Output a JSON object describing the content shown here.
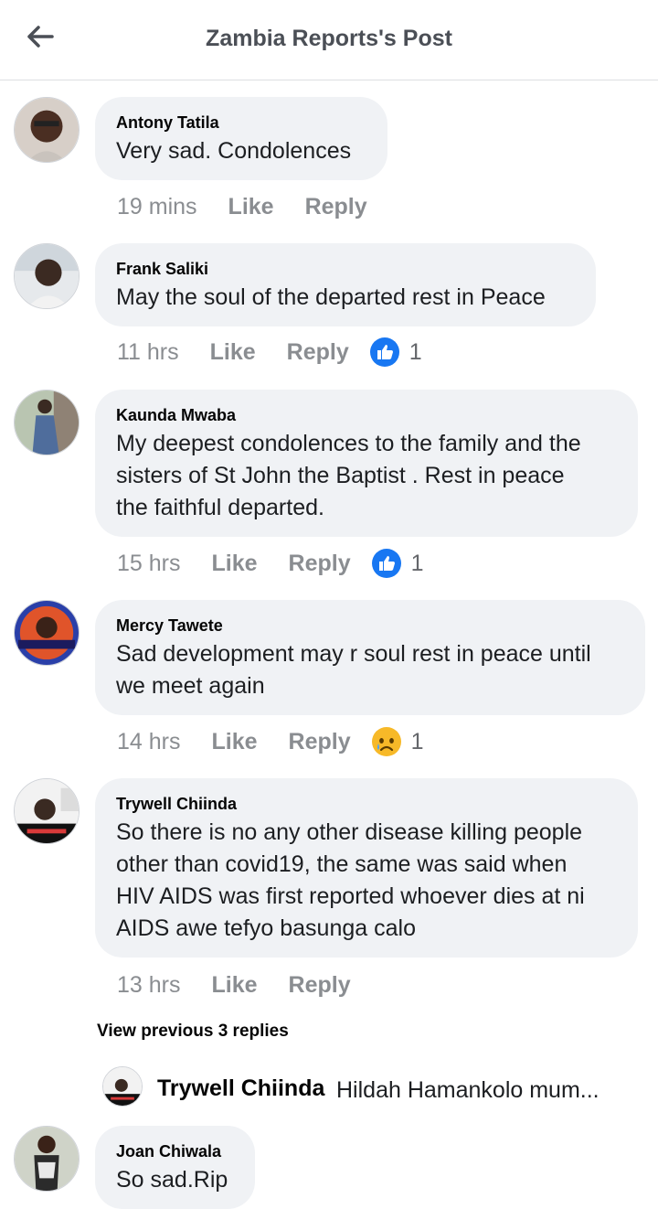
{
  "header": {
    "title": "Zambia Reports's Post"
  },
  "comments": [
    {
      "author": "Antony Tatila",
      "text": "Very sad. Condolences",
      "time": "19 mins",
      "like": "Like",
      "reply": "Reply",
      "reaction": "",
      "count": ""
    },
    {
      "author": "Frank Saliki",
      "text": "May the soul of the departed rest in Peace",
      "time": "11 hrs",
      "like": "Like",
      "reply": "Reply",
      "reaction": "like",
      "count": "1"
    },
    {
      "author": "Kaunda Mwaba",
      "text": "My deepest condolences to the family and the\nsisters of St John the Baptist . Rest in peace\nthe faithful departed.",
      "time": "15 hrs",
      "like": "Like",
      "reply": "Reply",
      "reaction": "like",
      "count": "1"
    },
    {
      "author": "Mercy Tawete",
      "text": "Sad development may r soul rest in peace until\nwe meet again",
      "time": "14 hrs",
      "like": "Like",
      "reply": "Reply",
      "reaction": "sad",
      "count": "1"
    },
    {
      "author": "Trywell Chiinda",
      "text": "So there is no any other disease killing people\nother than covid19, the same was said when\nHIV AIDS was first reported whoever dies at ni\nAIDS awe tefyo basunga calo",
      "time": "13 hrs",
      "like": "Like",
      "reply": "Reply",
      "reaction": "",
      "count": ""
    },
    {
      "author": "Joan Chiwala",
      "text": "So sad.Rip",
      "time": "",
      "like": "",
      "reply": "",
      "reaction": "",
      "count": ""
    }
  ],
  "view_previous": "View previous 3 replies",
  "reply_preview": {
    "author": "Trywell Chiinda",
    "text": "Hildah Hamankolo mum..."
  },
  "colors": {
    "bubble": "#f0f2f5",
    "meta": "#8a8d91",
    "like_blue": "#1877f2",
    "sad_yellow": "#f7b928"
  }
}
